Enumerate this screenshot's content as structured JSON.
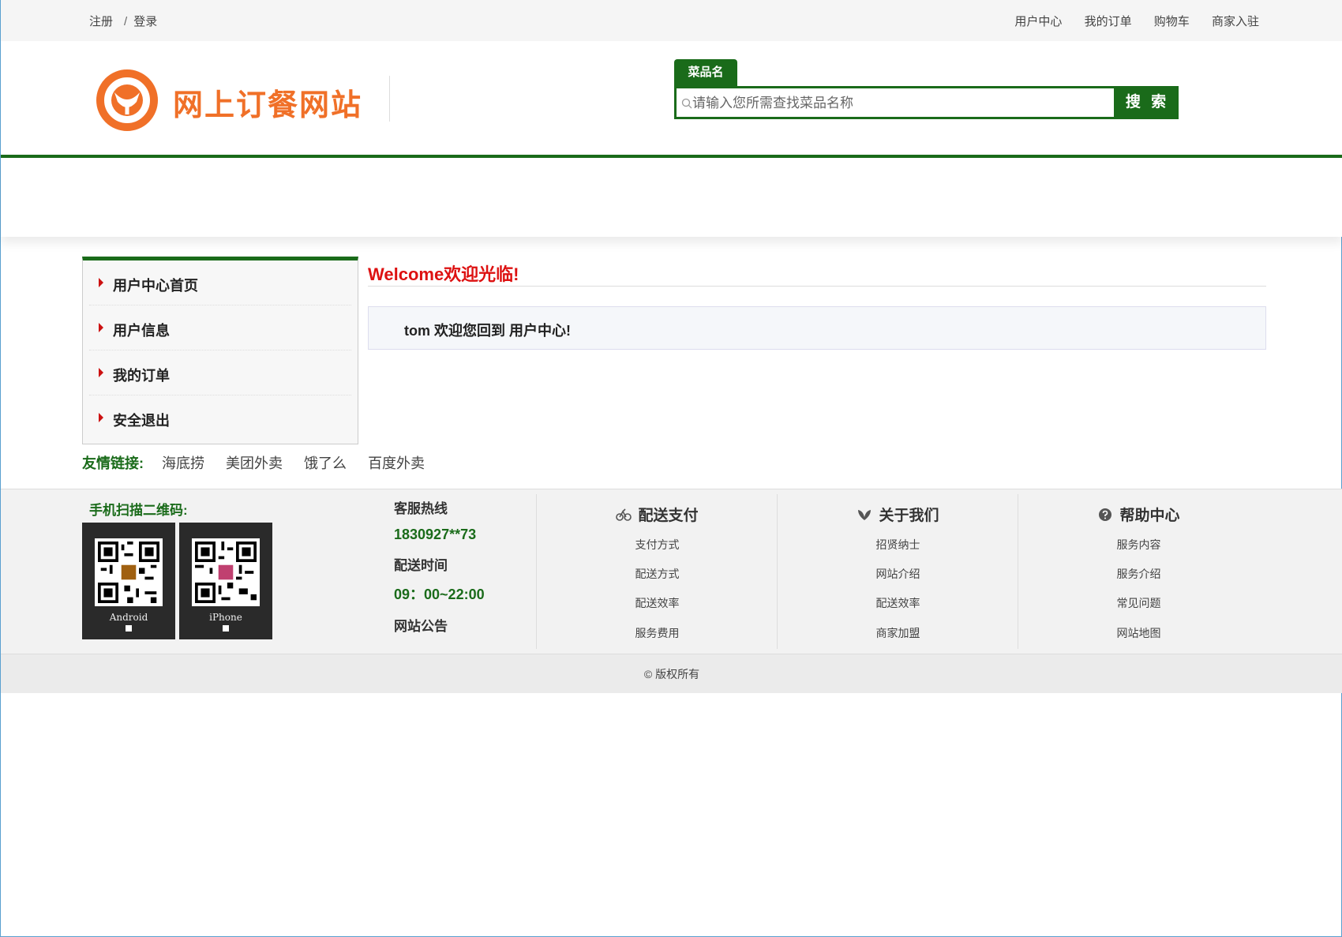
{
  "topbar": {
    "register": "注册",
    "separator": "/",
    "login": "登录",
    "links": [
      "用户中心",
      "我的订单",
      "购物车",
      "商家入驻"
    ]
  },
  "header": {
    "site_title": "网上订餐网站",
    "logo_icon": "logo-icon",
    "search_tab": "菜品名",
    "search_placeholder": "请输入您所需查找菜品名称",
    "search_button": "搜 索"
  },
  "sidebar": {
    "items": [
      {
        "label": "用户中心首页"
      },
      {
        "label": "用户信息"
      },
      {
        "label": "我的订单"
      },
      {
        "label": "安全退出"
      }
    ]
  },
  "main": {
    "welcome_title": "Welcome欢迎光临!",
    "welcome_message": "tom 欢迎您回到 用户中心!"
  },
  "friends": {
    "title": "友情链接:",
    "links": [
      "海底捞",
      "美团外卖",
      "饿了么",
      "百度外卖"
    ]
  },
  "footer": {
    "qr_title": "手机扫描二维码:",
    "qr_codes": [
      {
        "caption": "Android"
      },
      {
        "caption": "iPhone"
      }
    ],
    "contact": {
      "hotline_label": "客服热线",
      "hotline": "1830927**73",
      "hours_label": "配送时间",
      "hours": "09：00~22:00",
      "notice_label": "网站公告"
    },
    "columns": [
      {
        "title": "配送支付",
        "icon": "bike-icon",
        "items": [
          "支付方式",
          "配送方式",
          "配送效率",
          "服务费用"
        ]
      },
      {
        "title": "关于我们",
        "icon": "leaf-icon",
        "items": [
          "招贤纳士",
          "网站介绍",
          "配送效率",
          "商家加盟"
        ]
      },
      {
        "title": "帮助中心",
        "icon": "help-icon",
        "items": [
          "服务内容",
          "服务介绍",
          "常见问题",
          "网站地图"
        ]
      }
    ],
    "copyright": "© 版权所有"
  },
  "colors": {
    "brand_green": "#1a6b1a",
    "brand_orange": "#f07028",
    "accent_red": "#dd1111"
  }
}
